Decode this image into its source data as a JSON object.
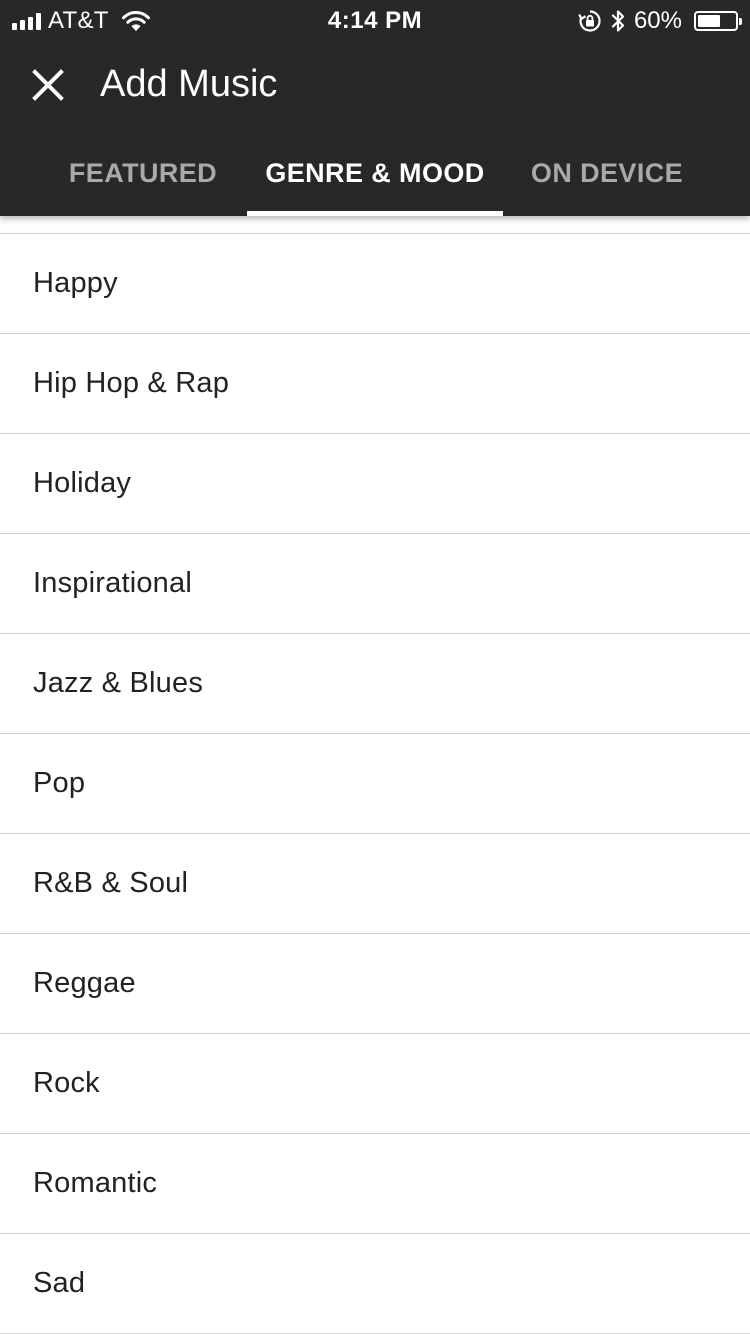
{
  "status_bar": {
    "carrier": "AT&T",
    "time": "4:14 PM",
    "battery_percent": "60%",
    "battery_level": 0.6,
    "icons": [
      "signal-icon",
      "wifi-icon",
      "rotation-lock-icon",
      "bluetooth-icon",
      "battery-icon"
    ]
  },
  "app_bar": {
    "title": "Add Music",
    "close_icon": "close-icon"
  },
  "tabs": [
    {
      "label": "FEATURED",
      "active": false
    },
    {
      "label": "GENRE & MOOD",
      "active": true
    },
    {
      "label": "ON DEVICE",
      "active": false
    }
  ],
  "genres": [
    {
      "label": "Happy"
    },
    {
      "label": "Hip Hop & Rap"
    },
    {
      "label": "Holiday"
    },
    {
      "label": "Inspirational"
    },
    {
      "label": "Jazz & Blues"
    },
    {
      "label": "Pop"
    },
    {
      "label": "R&B & Soul"
    },
    {
      "label": "Reggae"
    },
    {
      "label": "Rock"
    },
    {
      "label": "Romantic"
    },
    {
      "label": "Sad"
    }
  ],
  "colors": {
    "header_background": "#282828",
    "tab_active": "#ffffff",
    "tab_inactive": "#a9a9a9",
    "divider": "#cfcfcf",
    "item_text": "#222222"
  }
}
